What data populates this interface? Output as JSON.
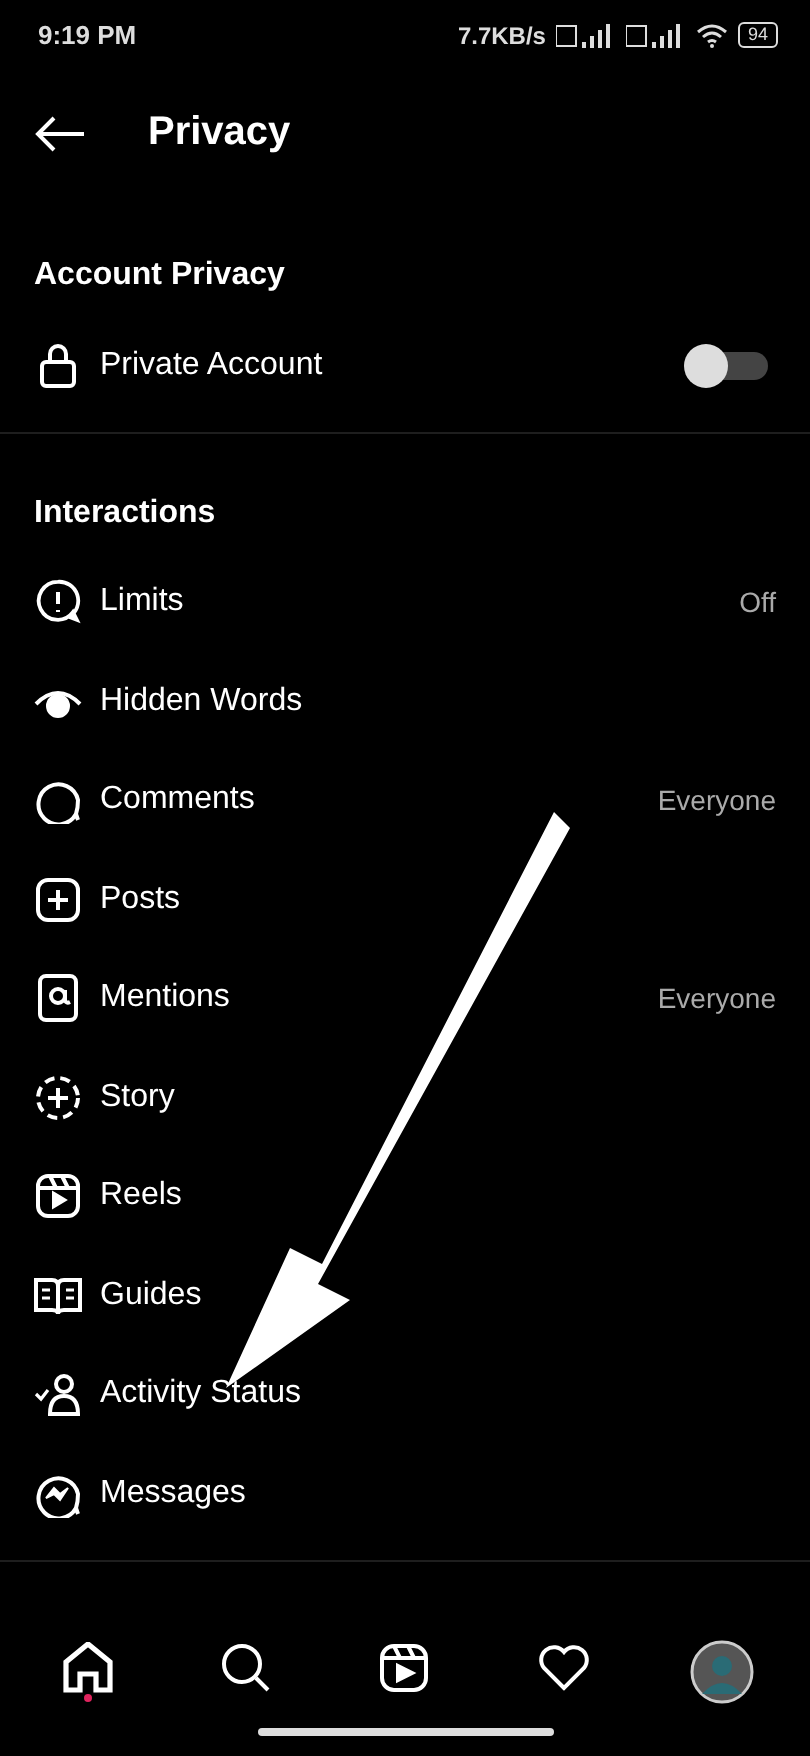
{
  "status_bar": {
    "time": "9:19 PM",
    "speed": "7.7KB/s",
    "battery": "94"
  },
  "header": {
    "title": "Privacy"
  },
  "sections": [
    {
      "title": "Account Privacy",
      "items": [
        {
          "kind": "lock",
          "label": "Private Account",
          "on": false
        }
      ]
    },
    {
      "title": "Interactions",
      "items": [
        {
          "kind": "limits",
          "label": "Limits",
          "value": "Off"
        },
        {
          "kind": "eye",
          "label": "Hidden Words"
        },
        {
          "kind": "bubble",
          "label": "Comments",
          "value": "Everyone"
        },
        {
          "kind": "plus",
          "label": "Posts"
        },
        {
          "kind": "at",
          "label": "Mentions",
          "value": "Everyone"
        },
        {
          "kind": "story",
          "label": "Story"
        },
        {
          "kind": "reels",
          "label": "Reels"
        },
        {
          "kind": "book",
          "label": "Guides"
        },
        {
          "kind": "activity",
          "label": "Activity Status"
        },
        {
          "kind": "messenger",
          "label": "Messages"
        }
      ]
    }
  ],
  "bottom_nav": [
    {
      "kind": "home",
      "selected": true
    },
    {
      "kind": "search",
      "selected": false
    },
    {
      "kind": "reels",
      "selected": false
    },
    {
      "kind": "heart",
      "selected": false
    },
    {
      "kind": "avatar",
      "selected": false
    }
  ]
}
